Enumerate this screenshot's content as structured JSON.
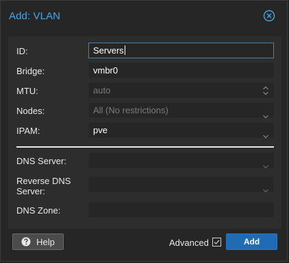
{
  "dialog": {
    "title": "Add: VLAN",
    "close_icon": "close-circle-icon"
  },
  "form": {
    "id": {
      "label": "ID:",
      "value": "Servers"
    },
    "bridge": {
      "label": "Bridge:",
      "value": "vmbr0"
    },
    "mtu": {
      "label": "MTU:",
      "placeholder": "auto"
    },
    "nodes": {
      "label": "Nodes:",
      "placeholder": "All (No restrictions)"
    },
    "ipam": {
      "label": "IPAM:",
      "value": "pve"
    },
    "dns_server": {
      "label": "DNS Server:",
      "value": ""
    },
    "reverse_dns_server": {
      "label_line1": "Reverse DNS",
      "label_line2": "Server:",
      "value": ""
    },
    "dns_zone": {
      "label": "DNS Zone:",
      "value": ""
    }
  },
  "footer": {
    "help_label": "Help",
    "help_icon": "question-circle-icon",
    "advanced_label": "Advanced",
    "advanced_checked": true,
    "add_label": "Add"
  },
  "colors": {
    "title": "#4ba5e3",
    "primary_button": "#1f6cb5",
    "focus_border": "#4a7fae"
  }
}
